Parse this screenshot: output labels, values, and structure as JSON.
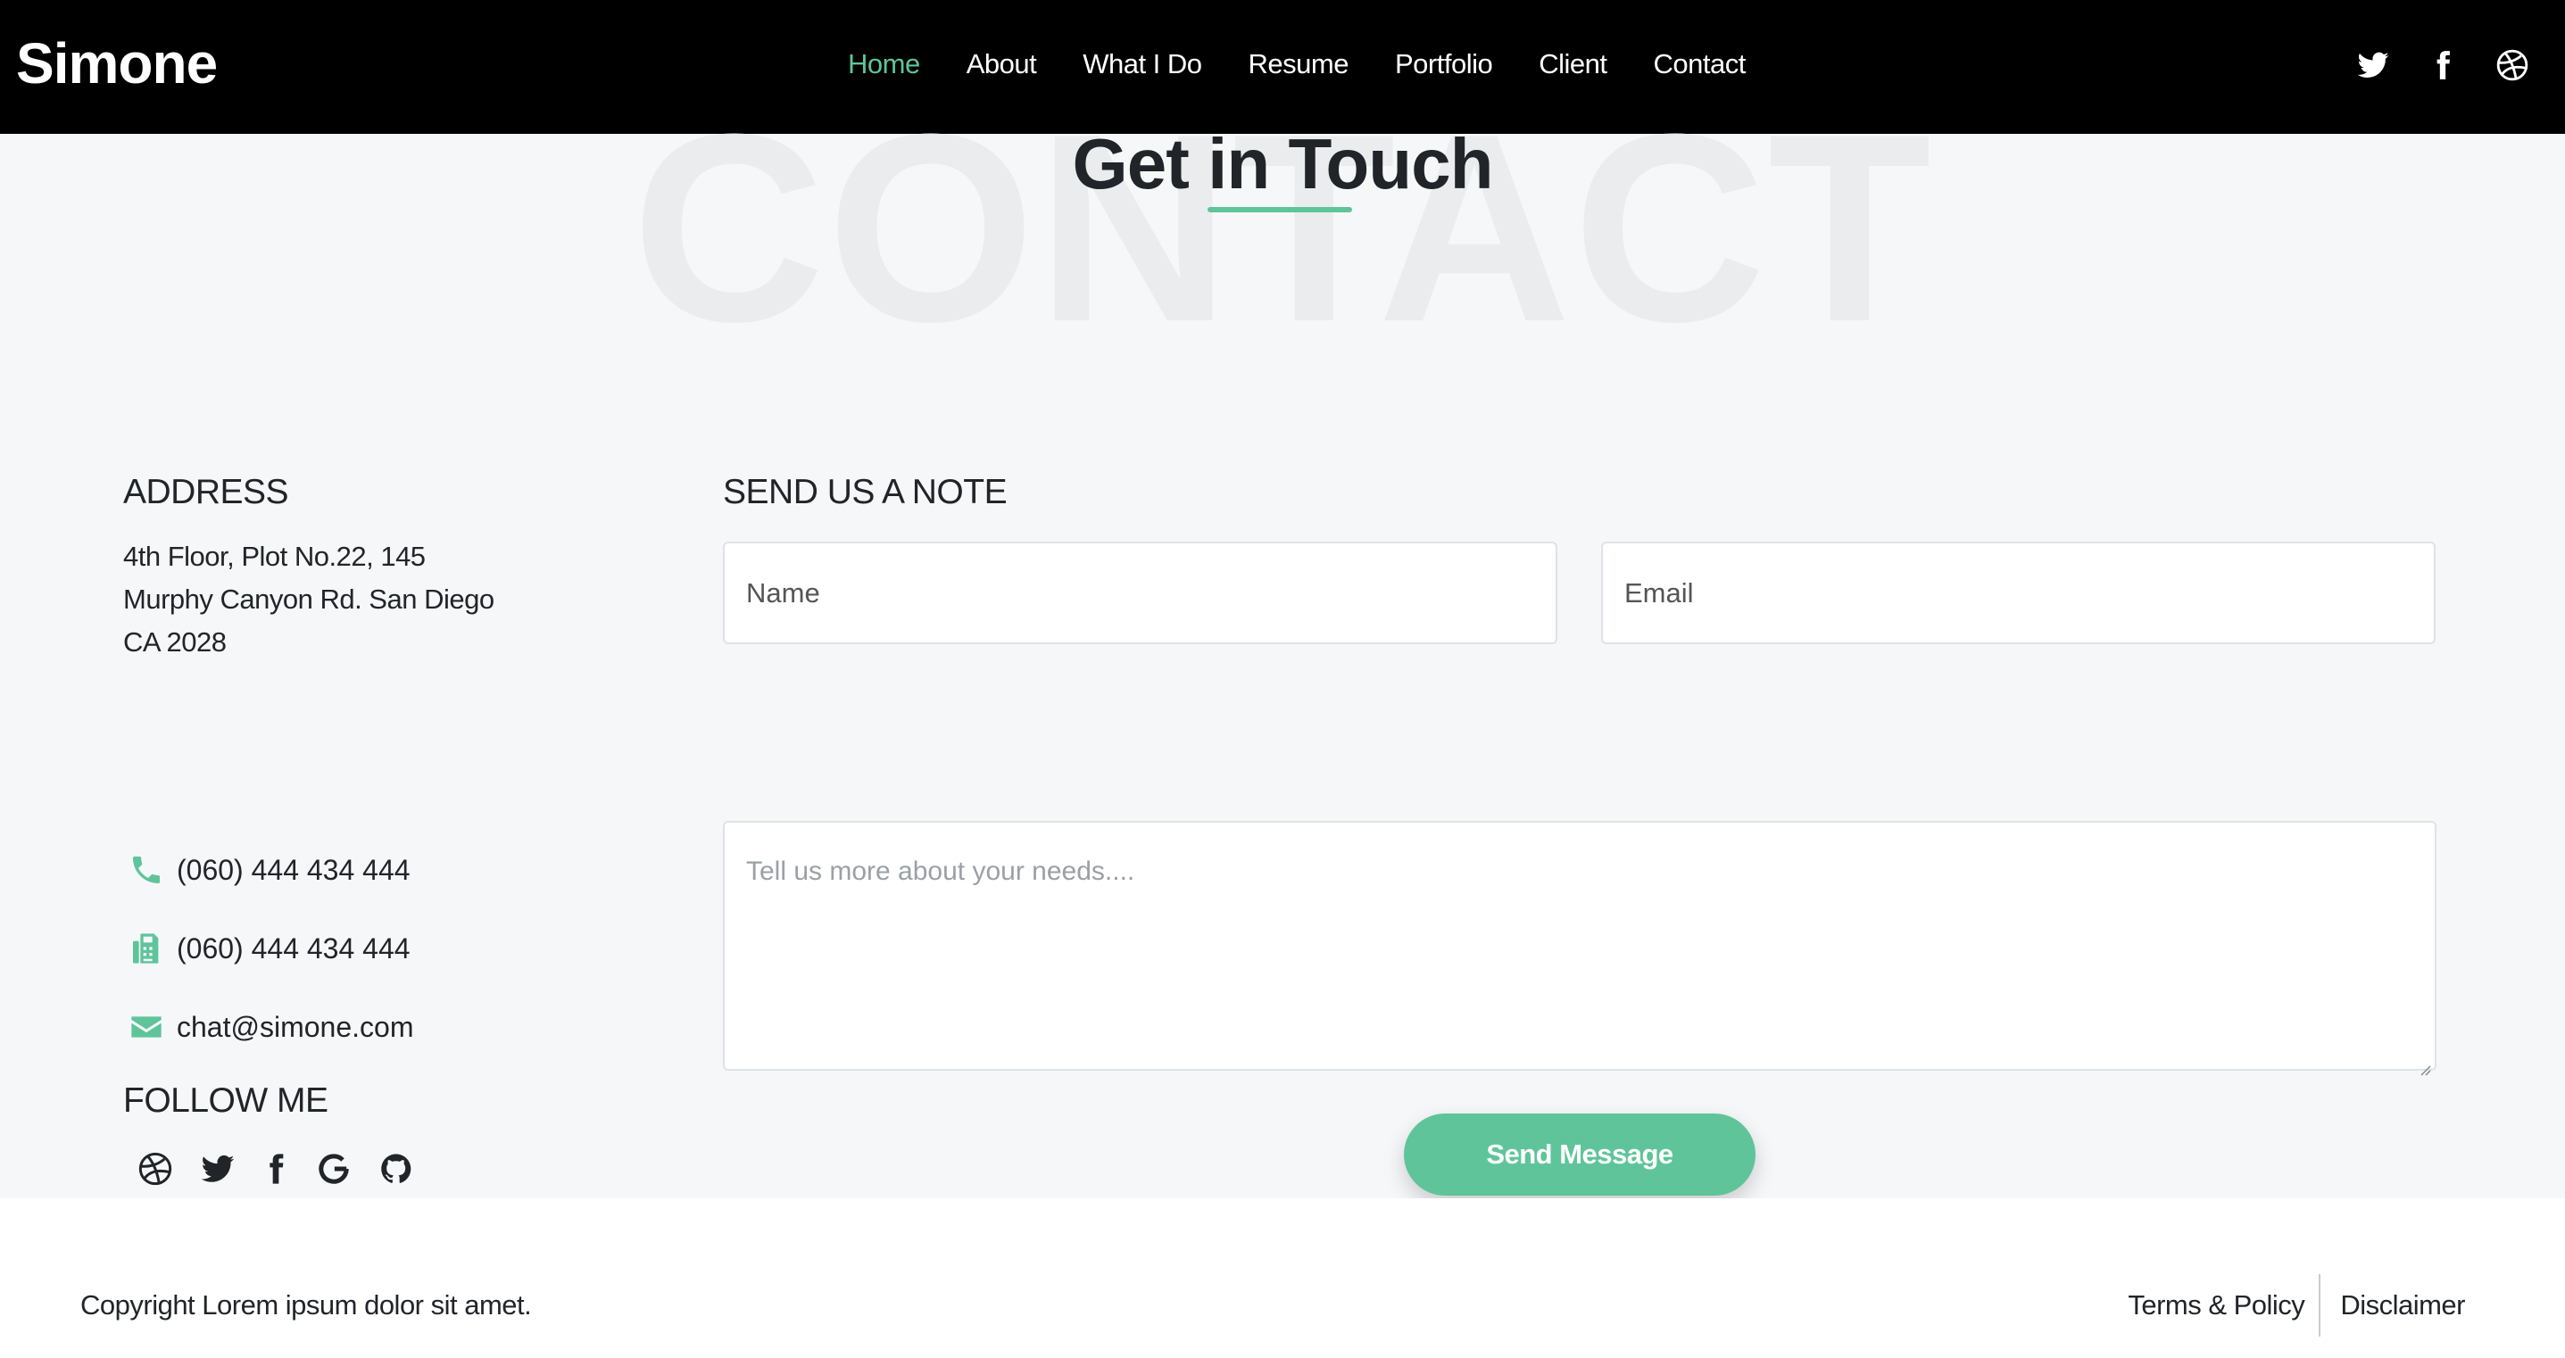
{
  "header": {
    "brand": "Simone",
    "nav": [
      {
        "label": "Home",
        "active": true
      },
      {
        "label": "About",
        "active": false
      },
      {
        "label": "What I Do",
        "active": false
      },
      {
        "label": "Resume",
        "active": false
      },
      {
        "label": "Portfolio",
        "active": false
      },
      {
        "label": "Client",
        "active": false
      },
      {
        "label": "Contact",
        "active": false
      }
    ],
    "icons": [
      "twitter-icon",
      "facebook-icon",
      "dribbble-icon"
    ]
  },
  "contact": {
    "background_word": "CONTACT",
    "title": "Get in Touch",
    "address_heading": "ADDRESS",
    "address_lines": [
      "4th Floor, Plot No.22, 145",
      "Murphy Canyon Rd. San Diego",
      "CA 2028"
    ],
    "phone": "(060) 444 434 444",
    "fax": "(060) 444 434 444",
    "email": "chat@simone.com",
    "follow_heading": "FOLLOW ME",
    "social_icons": [
      "dribbble-icon",
      "twitter-icon",
      "facebook-icon",
      "google-icon",
      "github-icon"
    ],
    "form": {
      "heading": "SEND US A NOTE",
      "name_placeholder": "Name",
      "email_placeholder": "Email",
      "message_placeholder": "Tell us more about your needs....",
      "submit_label": "Send Message"
    }
  },
  "footer": {
    "copyright": "Copyright Lorem ipsum dolor sit amet.",
    "links": [
      "Terms & Policy",
      "Disclaimer"
    ]
  },
  "colors": {
    "accent": "#5fc49a",
    "header_bg": "#000000",
    "section_bg": "#f6f7f9",
    "text": "#212529"
  }
}
